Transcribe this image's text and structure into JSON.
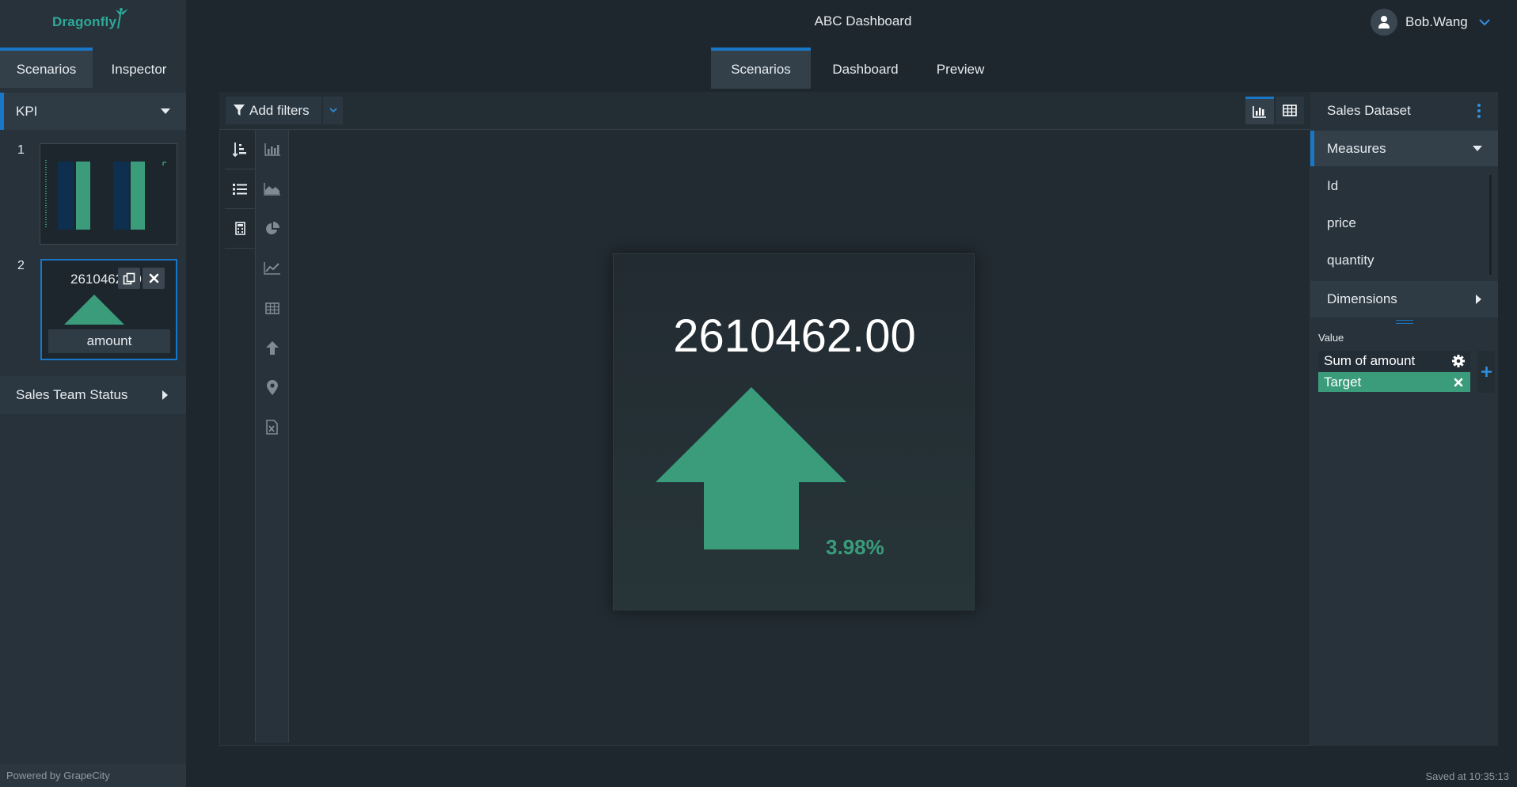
{
  "brand": {
    "logo_text": "Dragonfly",
    "powered_by": "Powered by GrapeCity"
  },
  "header": {
    "title": "ABC Dashboard"
  },
  "user": {
    "name": "Bob.Wang",
    "icon": "user-icon"
  },
  "left_panel": {
    "tabs": [
      {
        "label": "Scenarios",
        "active": true
      },
      {
        "label": "Inspector",
        "active": false
      }
    ],
    "sections": [
      {
        "label": "KPI",
        "expanded": true
      },
      {
        "label": "Sales Team Status",
        "expanded": false
      }
    ],
    "thumbnails": [
      {
        "number": "1",
        "type": "bar-chart"
      },
      {
        "number": "2",
        "value": "2610462.00",
        "caption": "amount",
        "actions": [
          "duplicate-icon",
          "close-icon"
        ]
      }
    ]
  },
  "main_tabs": [
    {
      "label": "Scenarios",
      "active": true
    },
    {
      "label": "Dashboard",
      "active": false
    },
    {
      "label": "Preview",
      "active": false
    }
  ],
  "toolbar": {
    "add_filters_label": "Add filters",
    "view_modes": [
      "chart-view-icon",
      "table-view-icon"
    ],
    "active_view": "chart-view-icon"
  },
  "tool_icons": {
    "column1": [
      "sort-icon",
      "list-icon",
      "calculator-icon"
    ],
    "column2": [
      "bar-chart-icon",
      "area-chart-icon",
      "pie-chart-icon",
      "line-chart-icon",
      "table-icon",
      "kpi-arrow-icon",
      "map-pin-icon",
      "excel-icon"
    ]
  },
  "kpi": {
    "value": "2610462.00",
    "change_percent": "3.98%",
    "direction": "up",
    "arrow_color": "#3a9c7b"
  },
  "right_panel": {
    "dataset_title": "Sales Dataset",
    "measures_label": "Measures",
    "measures": [
      "Id",
      "price",
      "quantity"
    ],
    "dimensions_label": "Dimensions",
    "value_label": "Value",
    "value_chips": [
      {
        "label": "Sum of amount",
        "icon": "gear-icon"
      },
      {
        "label": "Target",
        "icon": "close-icon"
      }
    ]
  },
  "status": {
    "saved_text": "Saved at 10:35:13"
  },
  "colors": {
    "accent": "#1877c7",
    "positive": "#3a9c7b",
    "background": "#1f272e"
  }
}
